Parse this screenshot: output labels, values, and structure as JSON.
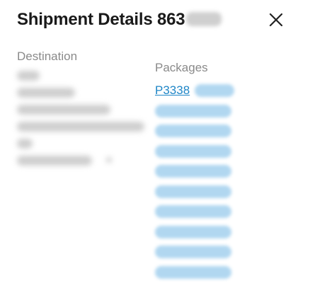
{
  "header": {
    "title": "Shipment Details 863",
    "close_icon": "close-icon"
  },
  "destination": {
    "label": "Destination"
  },
  "packages": {
    "label": "Packages",
    "first_link": "P3338"
  },
  "colors": {
    "link": "#1f86c7",
    "label": "#8a8a8a",
    "title": "#1a1a1a"
  }
}
